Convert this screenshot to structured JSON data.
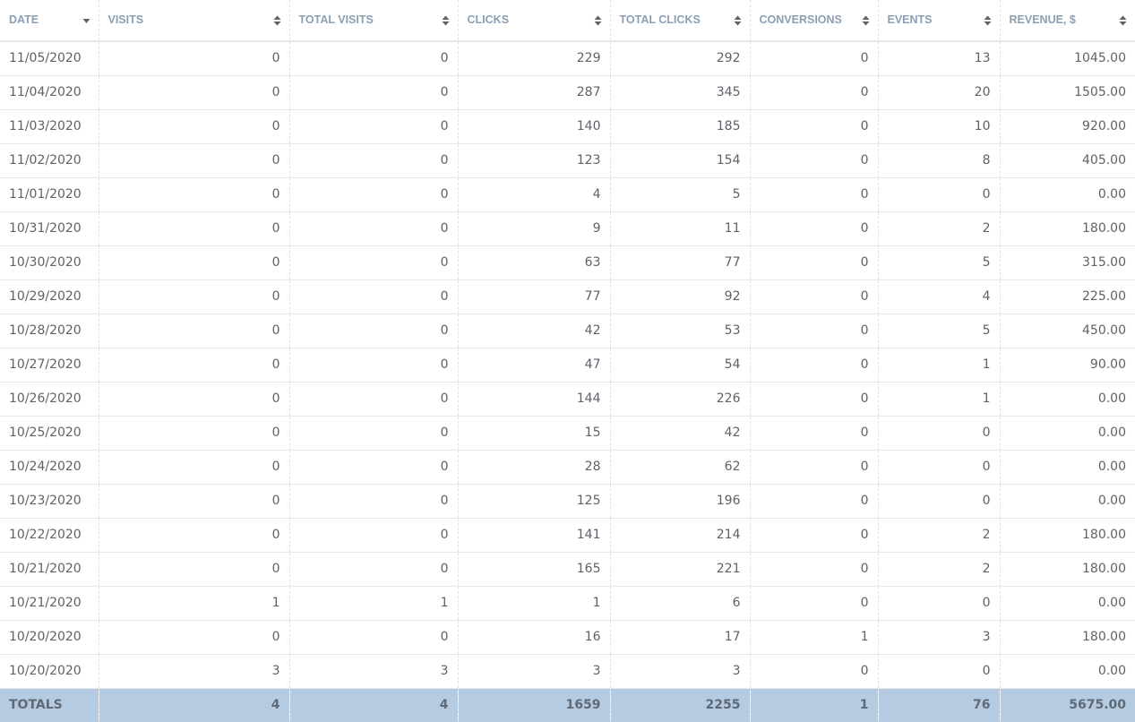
{
  "table": {
    "columns": [
      {
        "key": "date",
        "label": "DATE",
        "sort_icon": "sort-desc-icon"
      },
      {
        "key": "visits",
        "label": "VISITS",
        "sort_icon": "sort-both-icon"
      },
      {
        "key": "total_visits",
        "label": "TOTAL VISITS",
        "sort_icon": "sort-both-icon"
      },
      {
        "key": "clicks",
        "label": "CLICKS",
        "sort_icon": "sort-both-icon"
      },
      {
        "key": "total_clicks",
        "label": "TOTAL CLICKS",
        "sort_icon": "sort-both-icon"
      },
      {
        "key": "conversions",
        "label": "CONVERSIONS",
        "sort_icon": "sort-both-icon"
      },
      {
        "key": "events",
        "label": "EVENTS",
        "sort_icon": "sort-both-icon"
      },
      {
        "key": "revenue",
        "label": "REVENUE, $",
        "sort_icon": "sort-both-icon"
      }
    ],
    "rows": [
      [
        "11/05/2020",
        "0",
        "0",
        "229",
        "292",
        "0",
        "13",
        "1045.00"
      ],
      [
        "11/04/2020",
        "0",
        "0",
        "287",
        "345",
        "0",
        "20",
        "1505.00"
      ],
      [
        "11/03/2020",
        "0",
        "0",
        "140",
        "185",
        "0",
        "10",
        "920.00"
      ],
      [
        "11/02/2020",
        "0",
        "0",
        "123",
        "154",
        "0",
        "8",
        "405.00"
      ],
      [
        "11/01/2020",
        "0",
        "0",
        "4",
        "5",
        "0",
        "0",
        "0.00"
      ],
      [
        "10/31/2020",
        "0",
        "0",
        "9",
        "11",
        "0",
        "2",
        "180.00"
      ],
      [
        "10/30/2020",
        "0",
        "0",
        "63",
        "77",
        "0",
        "5",
        "315.00"
      ],
      [
        "10/29/2020",
        "0",
        "0",
        "77",
        "92",
        "0",
        "4",
        "225.00"
      ],
      [
        "10/28/2020",
        "0",
        "0",
        "42",
        "53",
        "0",
        "5",
        "450.00"
      ],
      [
        "10/27/2020",
        "0",
        "0",
        "47",
        "54",
        "0",
        "1",
        "90.00"
      ],
      [
        "10/26/2020",
        "0",
        "0",
        "144",
        "226",
        "0",
        "1",
        "0.00"
      ],
      [
        "10/25/2020",
        "0",
        "0",
        "15",
        "42",
        "0",
        "0",
        "0.00"
      ],
      [
        "10/24/2020",
        "0",
        "0",
        "28",
        "62",
        "0",
        "0",
        "0.00"
      ],
      [
        "10/23/2020",
        "0",
        "0",
        "125",
        "196",
        "0",
        "0",
        "0.00"
      ],
      [
        "10/22/2020",
        "0",
        "0",
        "141",
        "214",
        "0",
        "2",
        "180.00"
      ],
      [
        "10/21/2020",
        "0",
        "0",
        "165",
        "221",
        "0",
        "2",
        "180.00"
      ],
      [
        "10/21/2020",
        "1",
        "1",
        "1",
        "6",
        "0",
        "0",
        "0.00"
      ],
      [
        "10/20/2020",
        "0",
        "0",
        "16",
        "17",
        "1",
        "3",
        "180.00"
      ],
      [
        "10/20/2020",
        "3",
        "3",
        "3",
        "3",
        "0",
        "0",
        "0.00"
      ]
    ],
    "totals": {
      "label": "TOTALS",
      "values": [
        "4",
        "4",
        "1659",
        "2255",
        "1",
        "76",
        "5675.00"
      ]
    }
  },
  "colors": {
    "header_text": "#8b9fb3",
    "totals_bg": "#b4cbe2",
    "sort_icon": "#5f6368"
  }
}
